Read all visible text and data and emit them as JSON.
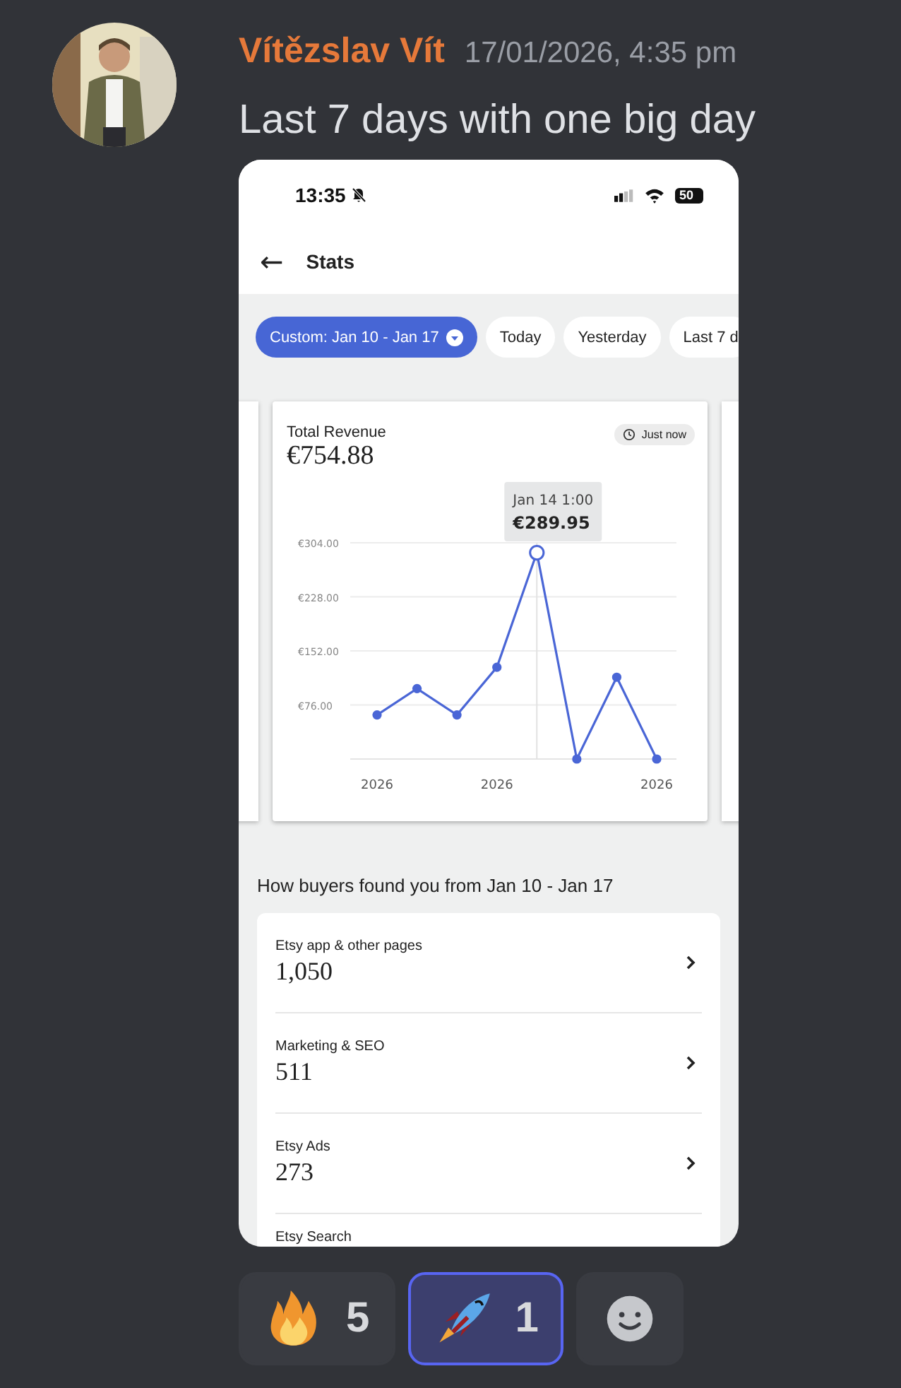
{
  "message": {
    "author": "Vítězslav Vít",
    "timestamp": "17/01/2026, 4:35 pm",
    "text": "Last 7 days with one big day"
  },
  "phone": {
    "status_bar": {
      "time": "13:35",
      "battery": "50"
    },
    "header": {
      "back": "←",
      "title": "Stats"
    },
    "chips": [
      {
        "label": "Custom: Jan 10 - Jan 17",
        "selected": true,
        "dropdown": true
      },
      {
        "label": "Today",
        "selected": false,
        "dropdown": false
      },
      {
        "label": "Yesterday",
        "selected": false,
        "dropdown": false
      },
      {
        "label": "Last 7 d",
        "selected": false,
        "dropdown": false
      }
    ],
    "revenue_card": {
      "title": "Total Revenue",
      "amount": "€754.88",
      "badge": "Just now",
      "tooltip": {
        "title": "Jan 14 1:00",
        "value": "€289.95"
      },
      "chart_data": {
        "type": "line",
        "categories": [
          "2026",
          null,
          null,
          "2026",
          null,
          null,
          null,
          "2026"
        ],
        "series": [
          {
            "color": "#4a66d6",
            "marker": "circle",
            "values": [
              62,
              99,
              62,
              129,
              290,
              0,
              115,
              0
            ]
          }
        ],
        "grid": true,
        "ylim": [
          0,
          304
        ],
        "yticks": [
          {
            "value": 76,
            "label": "€76.00"
          },
          {
            "value": 152,
            "label": "€152.00"
          },
          {
            "value": 228,
            "label": "€228.00"
          },
          {
            "value": 304,
            "label": "€304.00"
          }
        ]
      }
    },
    "section_title": "How buyers found you from Jan 10 - Jan 17",
    "sources": [
      {
        "label": "Etsy app & other pages",
        "value": "1,050"
      },
      {
        "label": "Marketing & SEO",
        "value": "511"
      },
      {
        "label": "Etsy Ads",
        "value": "273"
      },
      {
        "label": "Etsy Search"
      }
    ]
  },
  "reactions": [
    {
      "kind": "fire",
      "count": "5",
      "selected": false
    },
    {
      "kind": "rocket",
      "count": "1",
      "selected": true
    },
    {
      "kind": "add"
    }
  ]
}
